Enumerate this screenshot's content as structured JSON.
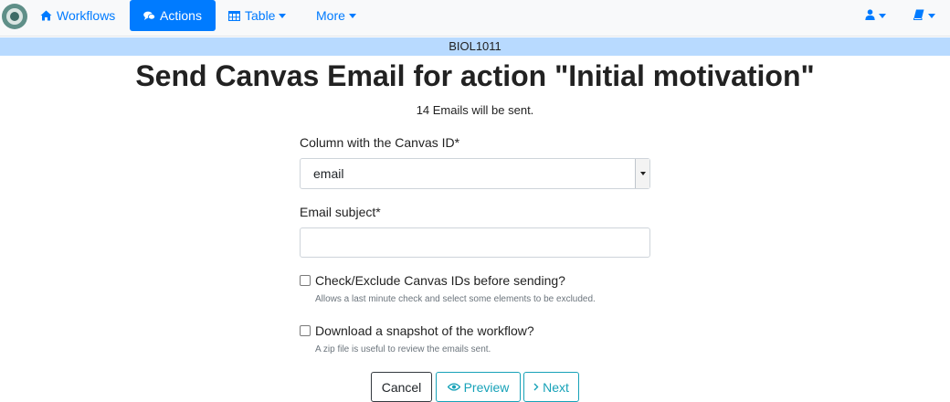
{
  "navbar": {
    "items": [
      {
        "label": "Workflows",
        "icon": "home-icon"
      },
      {
        "label": "Actions",
        "icon": "comments-icon",
        "active": true
      },
      {
        "label": "Table",
        "icon": "table-icon"
      },
      {
        "label": "More"
      }
    ],
    "right_icons": [
      "user-icon",
      "book-icon"
    ]
  },
  "course": {
    "name": "BIOL1011"
  },
  "header": {
    "title": "Send Canvas Email for action \"Initial motivation\"",
    "email_count_text": "14 Emails will be sent."
  },
  "form": {
    "canvas_id_label": "Column with the Canvas ID*",
    "canvas_id_value": "email",
    "subject_label": "Email subject*",
    "subject_value": "",
    "check_exclude_label": "Check/Exclude Canvas IDs before sending?",
    "check_exclude_help": "Allows a last minute check and select some elements to be excluded.",
    "check_exclude_checked": false,
    "download_snapshot_label": "Download a snapshot of the workflow?",
    "download_snapshot_help": "A zip file is useful to review the emails sent.",
    "download_snapshot_checked": false
  },
  "buttons": {
    "cancel": "Cancel",
    "preview": "Preview",
    "next": "Next"
  },
  "colors": {
    "primary": "#007bff",
    "info": "#17a2b8",
    "banner": "#b8daff",
    "navbar_bg": "#f8f9fa"
  }
}
